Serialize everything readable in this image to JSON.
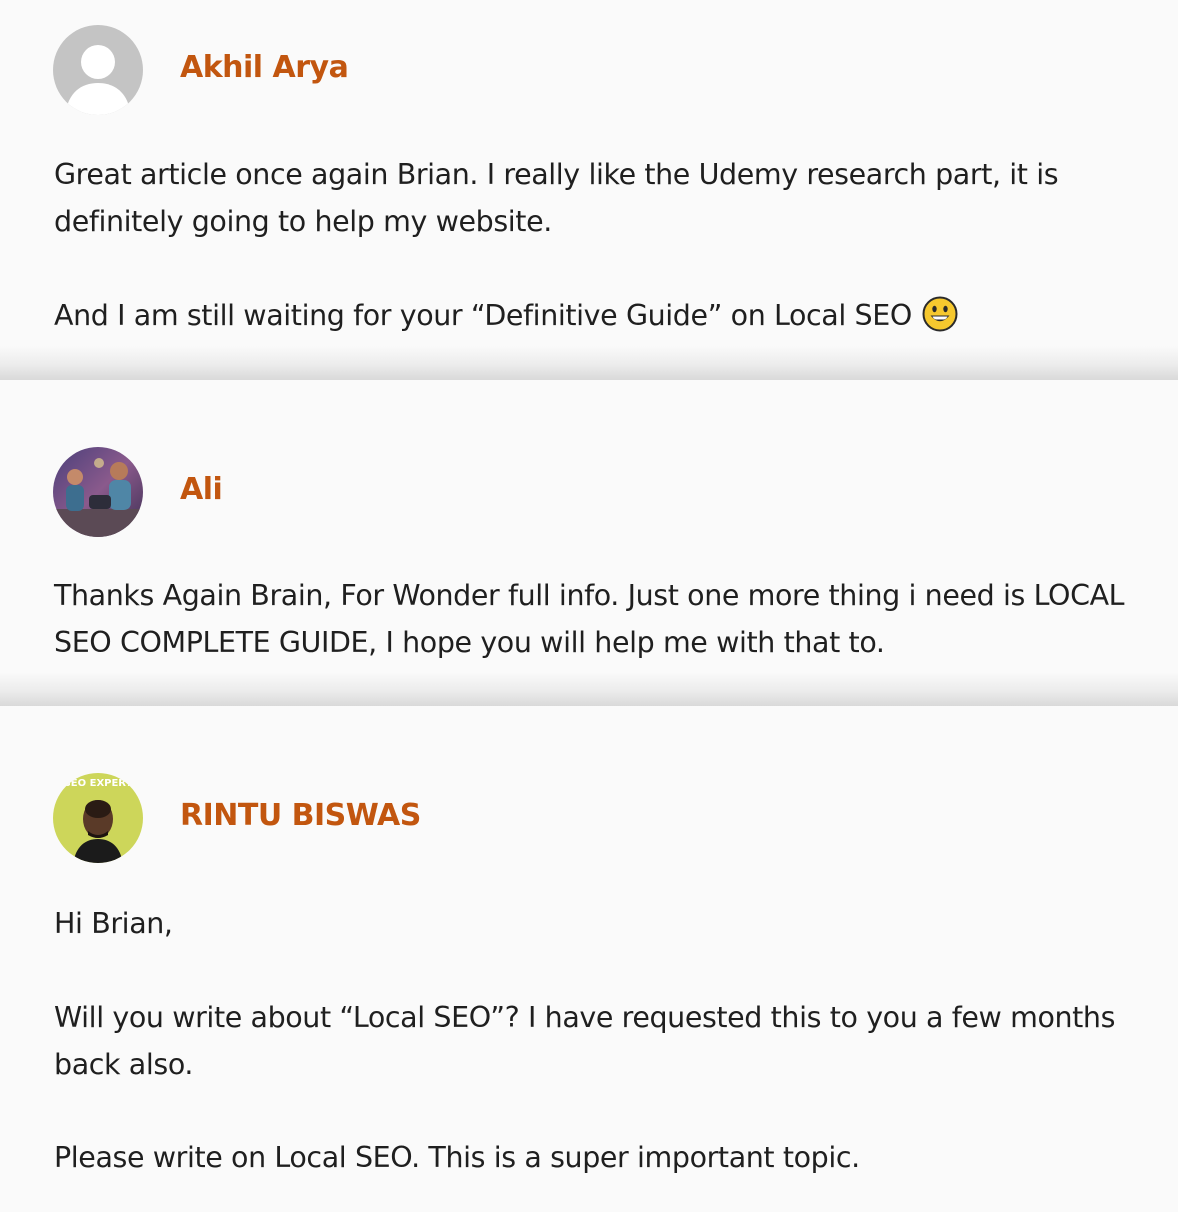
{
  "comments": [
    {
      "author": "Akhil Arya",
      "avatar_icon": "default-user-avatar-icon",
      "paragraphs": [
        "Great article once again Brian. I really like the Udemy research part, it is definitely going to help my website.",
        "And I am still waiting for your “Definitive Guide” on Local SEO"
      ],
      "emoji": "grinning-face-emoji"
    },
    {
      "author": "Ali",
      "avatar_icon": "photo-avatar-icon",
      "paragraphs": [
        "Thanks Again Brain, For Wonder full info. Just one more thing i need is LOCAL SEO COMPLETE GUIDE, I hope you will help me with that to."
      ]
    },
    {
      "author": "RINTU BISWAS",
      "avatar_icon": "photo-avatar-icon",
      "avatar_badge_text": "SEO EXPERT",
      "paragraphs": [
        "Hi Brian,",
        "Will you write about “Local SEO”? I have requested this to you a few months back also.",
        "Please write on Local SEO. This is a super important topic."
      ]
    }
  ],
  "colors": {
    "author": "#c2560f",
    "text": "#1f1f1f",
    "background": "#fafafa"
  }
}
